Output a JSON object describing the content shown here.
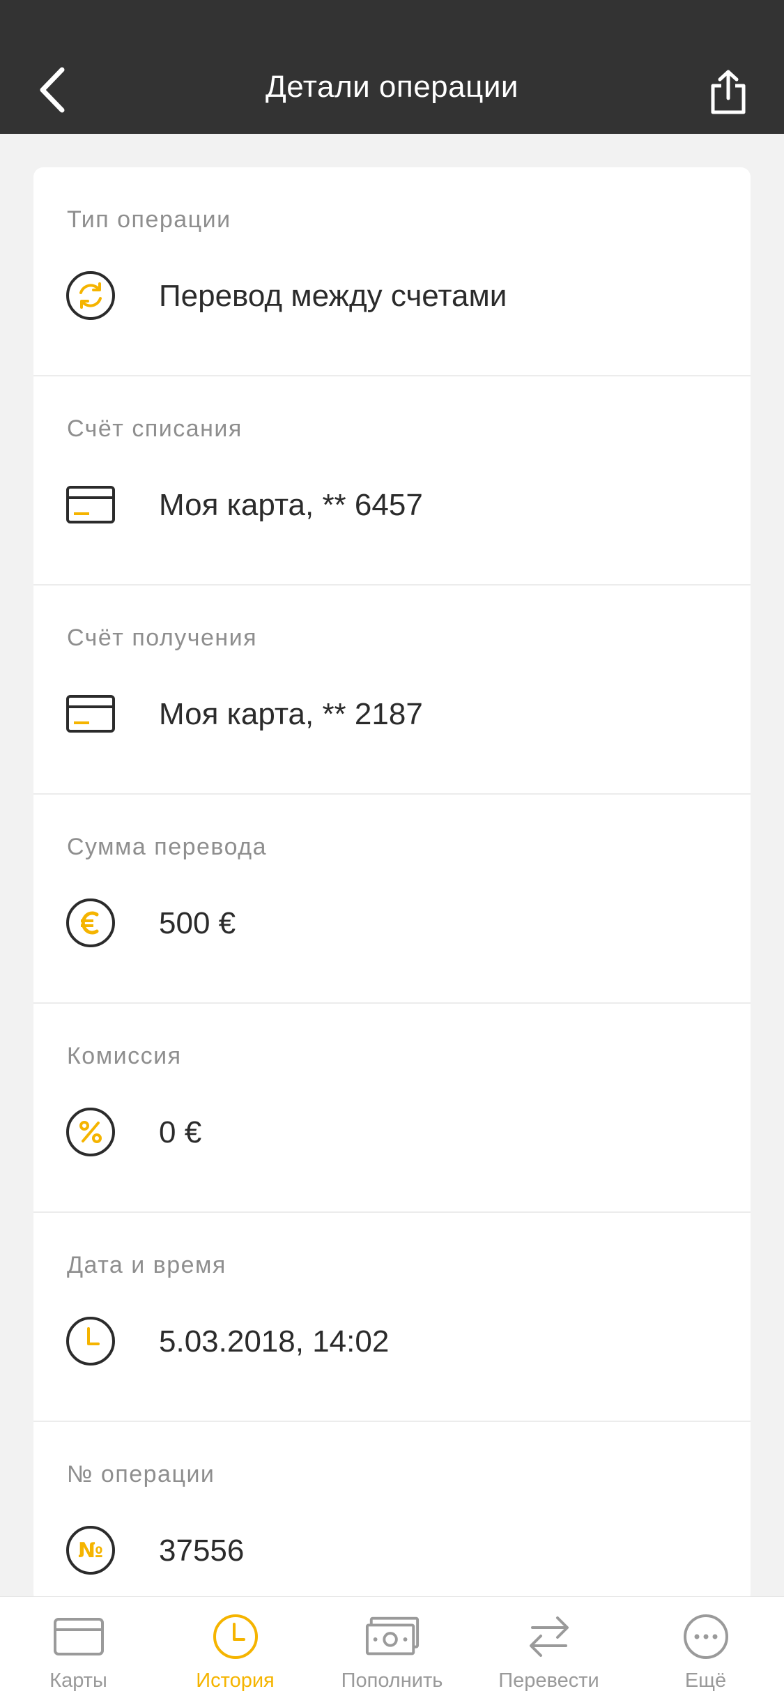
{
  "header": {
    "title": "Детали операции"
  },
  "colors": {
    "accent": "#f5b400",
    "header_bg": "#333333",
    "icon_stroke": "#2b2b2b",
    "inactive": "#9a9a9a"
  },
  "details": [
    {
      "label": "Тип операции",
      "value": "Перевод между счетами",
      "icon": "transfer-refresh-icon"
    },
    {
      "label": "Счёт списания",
      "value": "Моя карта, ** 6457",
      "icon": "card-icon"
    },
    {
      "label": "Счёт получения",
      "value": "Моя карта, ** 2187",
      "icon": "card-icon"
    },
    {
      "label": "Сумма перевода",
      "value": "500 €",
      "icon": "euro-icon"
    },
    {
      "label": "Комиссия",
      "value": "0 €",
      "icon": "percent-icon"
    },
    {
      "label": "Дата и время",
      "value": "5.03.2018, 14:02",
      "icon": "clock-icon"
    },
    {
      "label": "№ операции",
      "value": "37556",
      "icon": "number-icon"
    }
  ],
  "tabbar": [
    {
      "label": "Карты",
      "icon": "cards-icon",
      "active": false
    },
    {
      "label": "История",
      "icon": "history-icon",
      "active": true
    },
    {
      "label": "Пополнить",
      "icon": "topup-icon",
      "active": false
    },
    {
      "label": "Перевести",
      "icon": "transfer-arrows-icon",
      "active": false
    },
    {
      "label": "Ещё",
      "icon": "more-icon",
      "active": false
    }
  ]
}
